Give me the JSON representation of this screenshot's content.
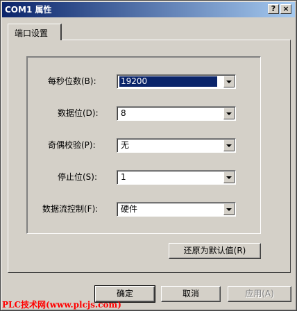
{
  "window": {
    "title": "COM1 属性"
  },
  "titlebar_buttons": {
    "help": "?",
    "close": "×"
  },
  "tab": {
    "label": "端口设置"
  },
  "fields": [
    {
      "label": "每秒位数(B):",
      "value": "19200"
    },
    {
      "label": "数据位(D):",
      "value": "8"
    },
    {
      "label": "奇偶校验(P):",
      "value": "无"
    },
    {
      "label": "停止位(S):",
      "value": "1"
    },
    {
      "label": "数据流控制(F):",
      "value": "硬件"
    }
  ],
  "restore_button": "还原为默认值(R)",
  "buttons": {
    "ok": "确定",
    "cancel": "取消",
    "apply": "应用(A)"
  },
  "watermark": "PLC技术网(www.plcjs.com)",
  "colors": {
    "titlebar_start": "#0a246a",
    "titlebar_end": "#a6caf0",
    "face": "#d4d0c8",
    "watermark": "#ff0000"
  }
}
